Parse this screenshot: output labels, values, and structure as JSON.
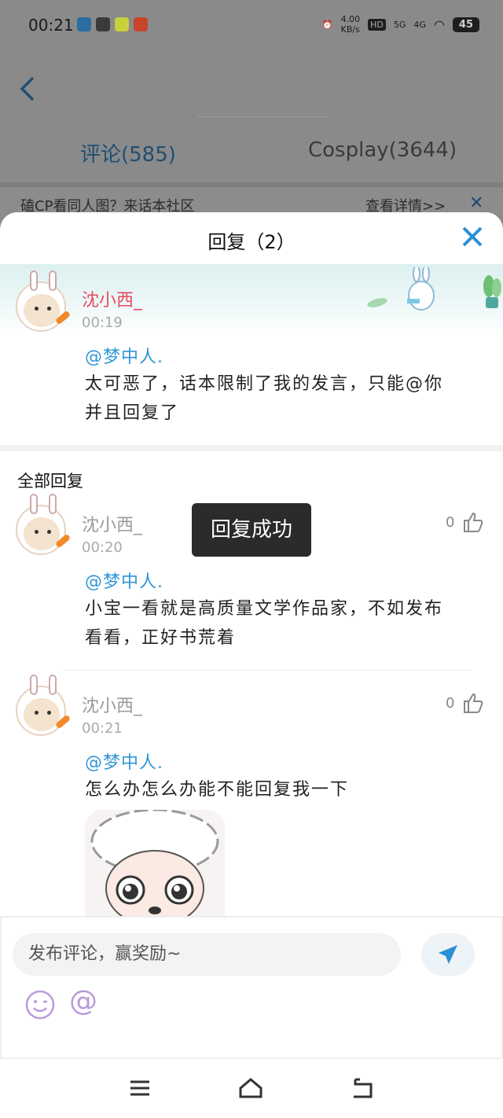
{
  "status_bar": {
    "time": "00:21",
    "net_speed": "4.00",
    "net_unit": "KB/s",
    "signal_5g": "5G",
    "signal_4g": "4G",
    "hd": "HD",
    "battery": "45"
  },
  "header": {
    "tabs": [
      {
        "label": "评论(585)"
      },
      {
        "label": "Cosplay(3644)"
      }
    ],
    "banner_text": "磕CP看同人图？来话本社区",
    "banner_link": "查看详情>>"
  },
  "sheet": {
    "title": "回复（2）",
    "original": {
      "name": "沈小西_",
      "time": "00:19",
      "mention": "@梦中人.",
      "text_line1": "太可恶了，话本限制了我的发言，只能@你",
      "text_line2": "并且回复了"
    },
    "all_replies_label": "全部回复",
    "replies": [
      {
        "name": "沈小西_",
        "time": "00:20",
        "likes": "0",
        "mention": "@梦中人.",
        "text_line1": "小宝一看就是高质量文学作品家，不如发布",
        "text_line2": "看看，正好书荒着"
      },
      {
        "name": "沈小西_",
        "time": "00:21",
        "likes": "0",
        "mention": "@梦中人.",
        "text_line1": "怎么办怎么办能不能回复我一下"
      }
    ],
    "toast": "回复成功",
    "composer_placeholder": "发布评论，赢奖励~",
    "at_symbol": "@"
  },
  "colors": {
    "accent_blue": "#3096d6",
    "name_red": "#e8495f",
    "close_blue": "#2a8fd6"
  }
}
